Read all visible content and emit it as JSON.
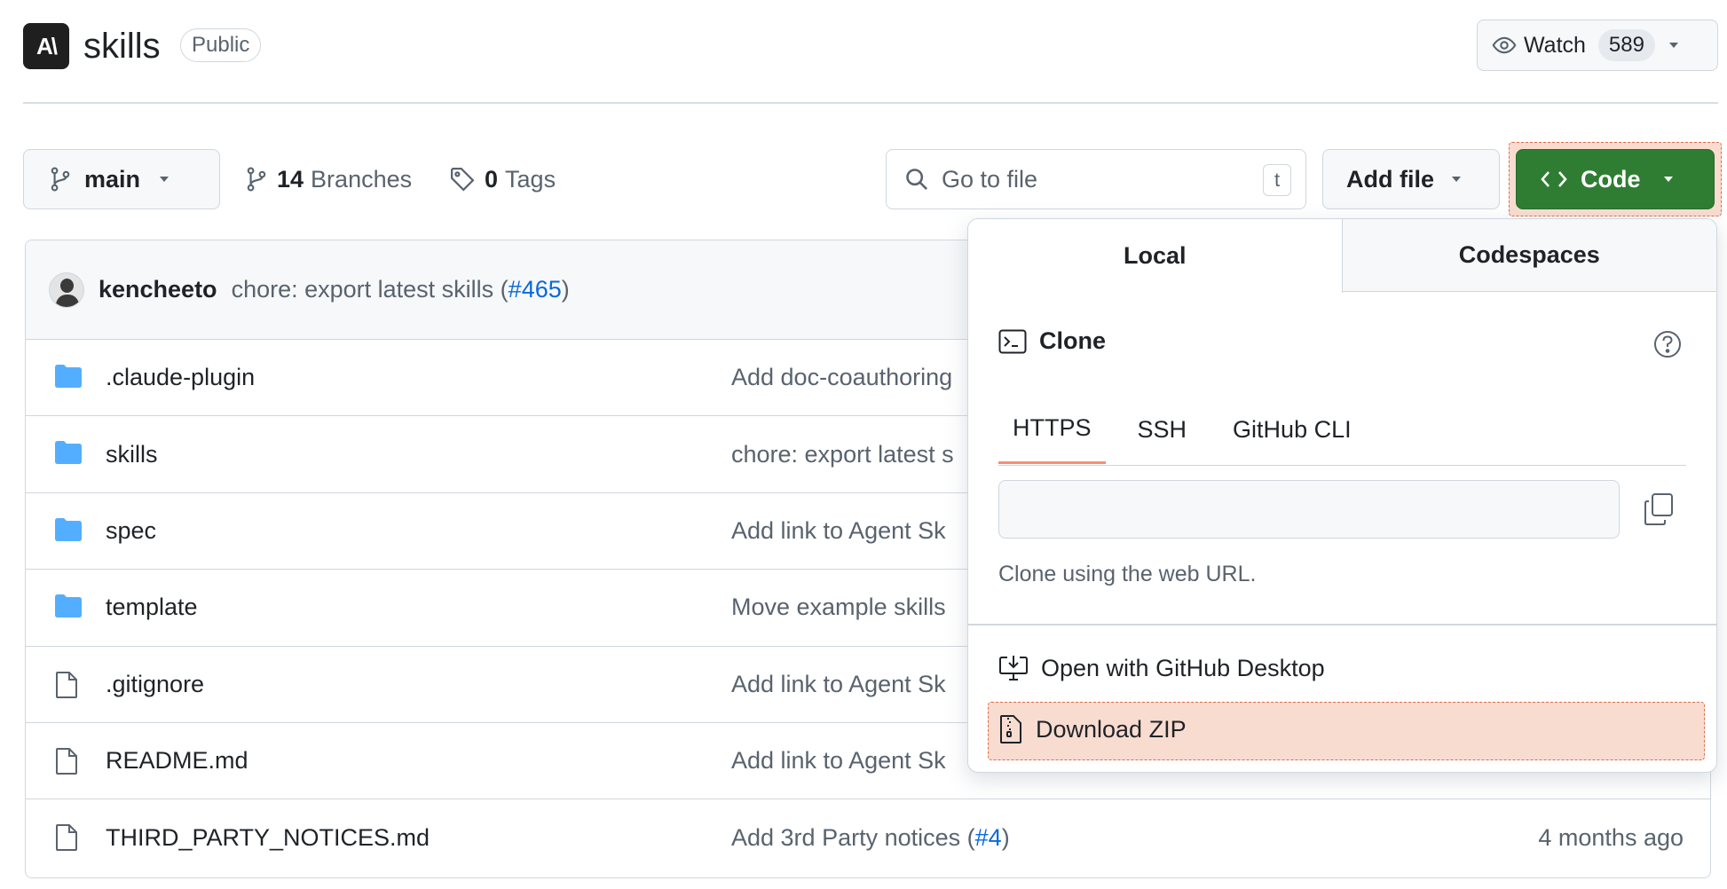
{
  "repo": {
    "logo_text": "A\\",
    "name": "skills",
    "visibility": "Public",
    "watch_label": "Watch",
    "watch_count": "589"
  },
  "toolbar": {
    "branch": "main",
    "branches_count": "14",
    "branches_label": "Branches",
    "tags_count": "0",
    "tags_label": "Tags",
    "search_placeholder": "Go to file",
    "search_shortcut": "t",
    "add_file_label": "Add file",
    "code_label": "Code"
  },
  "latest_commit": {
    "author": "kencheeto",
    "message": "chore: export latest skills (",
    "pr": "#465",
    "message_end": ")"
  },
  "files": [
    {
      "name": ".claude-plugin",
      "type": "folder",
      "commit": "Add doc-coauthoring",
      "date": ""
    },
    {
      "name": "skills",
      "type": "folder",
      "commit": "chore: export latest s",
      "date": ""
    },
    {
      "name": "spec",
      "type": "folder",
      "commit": "Add link to Agent Sk",
      "date": ""
    },
    {
      "name": "template",
      "type": "folder",
      "commit": "Move example skills",
      "date": ""
    },
    {
      "name": ".gitignore",
      "type": "file",
      "commit": "Add link to Agent Sk",
      "date": ""
    },
    {
      "name": "README.md",
      "type": "file",
      "commit": "Add link to Agent Sk",
      "date": ""
    },
    {
      "name": "THIRD_PARTY_NOTICES.md",
      "type": "file",
      "commit": "Add 3rd Party notices (",
      "commit_pr": "#4",
      "commit_end": ")",
      "date": "4 months ago"
    }
  ],
  "code_dropdown": {
    "tabs": [
      "Local",
      "Codespaces"
    ],
    "clone_title": "Clone",
    "protocols": [
      "HTTPS",
      "SSH",
      "GitHub CLI"
    ],
    "url_value": "",
    "help_text": "Clone using the web URL.",
    "open_desktop": "Open with GitHub Desktop",
    "download_zip": "Download ZIP"
  },
  "colors": {
    "code_button": "#2f7d32",
    "highlight": "#f9dcd0",
    "link": "#0969da",
    "folder_icon": "#54aeff",
    "active_tab_underline": "#fd8c73"
  }
}
